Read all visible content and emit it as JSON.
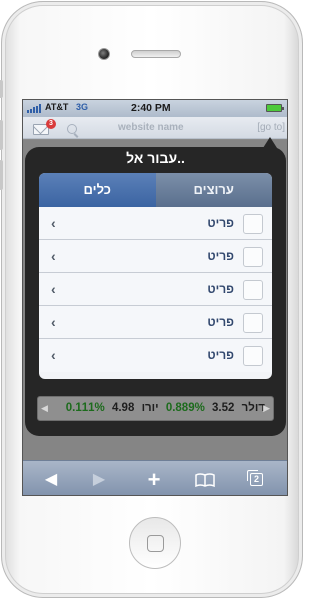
{
  "status_bar": {
    "carrier": "AT&T",
    "network": "3G",
    "time": "2:40 PM"
  },
  "nav_bar": {
    "mail_badge": "3",
    "site_name": "website name",
    "goto_label": "[go to]"
  },
  "popover": {
    "title": "..עבור אל",
    "tabs": [
      {
        "label": "ערוצים",
        "active": false
      },
      {
        "label": "כלים",
        "active": true
      }
    ],
    "items": [
      {
        "label": "פריט",
        "chevron": "‹"
      },
      {
        "label": "פריט",
        "chevron": "‹"
      },
      {
        "label": "פריט",
        "chevron": "‹"
      },
      {
        "label": "פריט",
        "chevron": "‹"
      },
      {
        "label": "פריט",
        "chevron": "‹"
      }
    ]
  },
  "ticker": {
    "dollar_label": "דולר",
    "dollar_value": "3.52",
    "dollar_change": "0.889%",
    "euro_label": "יורו",
    "euro_value": "4.98",
    "euro_change": "0.111%",
    "positive_color": "#1c6b1c"
  },
  "toolbar": {
    "back_icon": "◀",
    "forward_icon": "▶",
    "add_icon": "+",
    "bookmarks_icon": "📖",
    "pages_count": "2"
  },
  "colors": {
    "tab_active": "#3b64a2",
    "tab_inactive": "#5a6f8d",
    "popover_bg": "#262626",
    "toolbar": "#8092ac"
  }
}
